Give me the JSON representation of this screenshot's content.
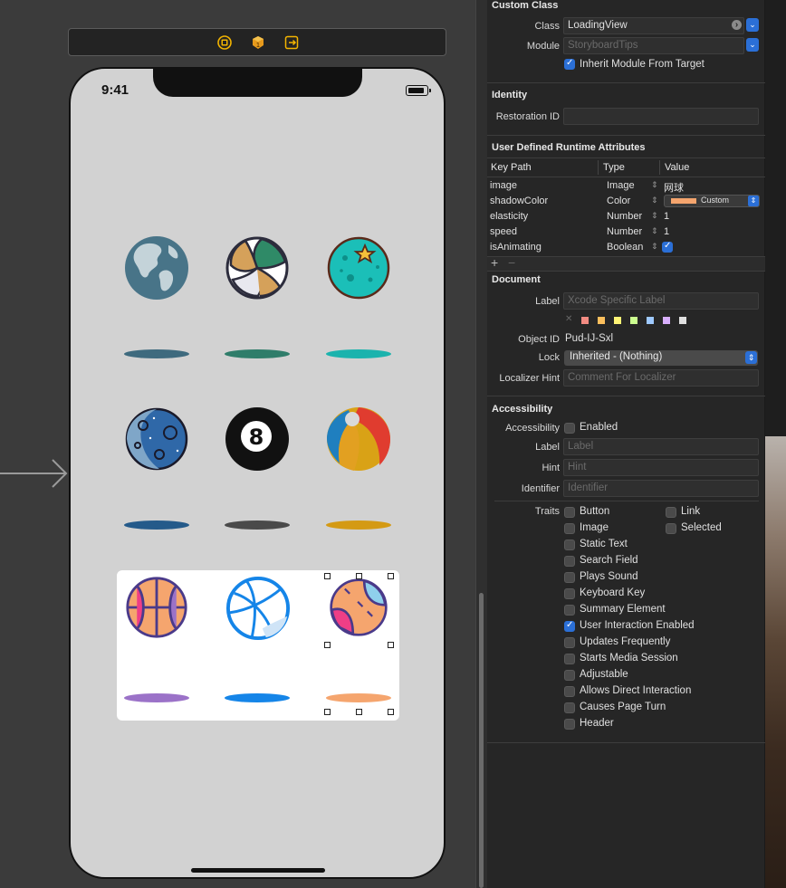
{
  "dock": {
    "icons": [
      "view-controller-icon",
      "first-responder-icon",
      "exit-icon"
    ]
  },
  "device": {
    "time": "9:41"
  },
  "balls": [
    {
      "name": "earth",
      "shadow_color": "#3e6a7e"
    },
    {
      "name": "volleyball",
      "shadow_color": "#2f7d6a"
    },
    {
      "name": "teal-star-ball",
      "shadow_color": "#1bb3ad"
    },
    {
      "name": "blue-moon-ball",
      "shadow_color": "#245a8a"
    },
    {
      "name": "eight-ball",
      "shadow_color": "#4a4a4a"
    },
    {
      "name": "beach-ball",
      "shadow_color": "#d49a14"
    },
    {
      "name": "basketball-pink",
      "shadow_color": "#9b72c8"
    },
    {
      "name": "basketball-blue",
      "shadow_color": "#1585e8"
    },
    {
      "name": "baseball",
      "shadow_color": "#f5a56e"
    }
  ],
  "inspector": {
    "custom_class": {
      "header": "Custom Class",
      "class_label": "Class",
      "class_value": "LoadingView",
      "module_label": "Module",
      "module_placeholder": "StoryboardTips",
      "inherit_label": "Inherit Module From Target",
      "inherit_checked": true
    },
    "identity": {
      "header": "Identity",
      "restoration_id_label": "Restoration ID",
      "restoration_id_value": ""
    },
    "runtime_attributes": {
      "header": "User Defined Runtime Attributes",
      "columns": [
        "Key Path",
        "Type",
        "Value"
      ],
      "rows": [
        {
          "key": "image",
          "type": "Image",
          "value": "网球"
        },
        {
          "key": "shadowColor",
          "type": "Color",
          "value": "Custom",
          "swatch": "#f5a56e"
        },
        {
          "key": "elasticity",
          "type": "Number",
          "value": "1"
        },
        {
          "key": "speed",
          "type": "Number",
          "value": "1"
        },
        {
          "key": "isAnimating",
          "type": "Boolean",
          "value": "",
          "checked": true
        }
      ],
      "add_label": "+",
      "remove_label": "−"
    },
    "document": {
      "header": "Document",
      "label_label": "Label",
      "label_placeholder": "Xcode Specific Label",
      "swatches": [
        "#f28b82",
        "#fbbf5d",
        "#fff475",
        "#ccff90",
        "#9ec9ff",
        "#d7aefb",
        "#e0e0e0"
      ],
      "object_id_label": "Object ID",
      "object_id_value": "Pud-IJ-Sxl",
      "lock_label": "Lock",
      "lock_value": "Inherited - (Nothing)",
      "localizer_label": "Localizer Hint",
      "localizer_placeholder": "Comment For Localizer"
    },
    "accessibility": {
      "header": "Accessibility",
      "accessibility_label": "Accessibility",
      "enabled_label": "Enabled",
      "label_label": "Label",
      "label_placeholder": "Label",
      "hint_label": "Hint",
      "hint_placeholder": "Hint",
      "identifier_label": "Identifier",
      "identifier_placeholder": "Identifier",
      "traits_label": "Traits",
      "traits_left": [
        {
          "label": "Button",
          "checked": false
        },
        {
          "label": "Image",
          "checked": false
        },
        {
          "label": "Static Text",
          "checked": false
        },
        {
          "label": "Search Field",
          "checked": false
        },
        {
          "label": "Plays Sound",
          "checked": false
        },
        {
          "label": "Keyboard Key",
          "checked": false
        },
        {
          "label": "Summary Element",
          "checked": false
        },
        {
          "label": "User Interaction Enabled",
          "checked": true
        },
        {
          "label": "Updates Frequently",
          "checked": false
        },
        {
          "label": "Starts Media Session",
          "checked": false
        },
        {
          "label": "Adjustable",
          "checked": false
        },
        {
          "label": "Allows Direct Interaction",
          "checked": false
        },
        {
          "label": "Causes Page Turn",
          "checked": false
        },
        {
          "label": "Header",
          "checked": false
        }
      ],
      "traits_right": [
        {
          "label": "Link",
          "checked": false
        },
        {
          "label": "Selected",
          "checked": false
        }
      ]
    }
  }
}
